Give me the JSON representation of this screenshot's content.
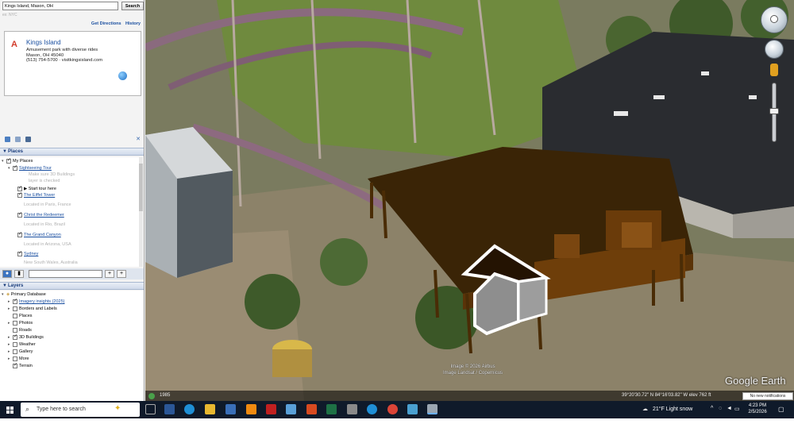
{
  "search": {
    "value": "Kings Island, Mason, OH",
    "button": "Search",
    "hint": "ex: NYC"
  },
  "links": {
    "directions": "Get Directions",
    "history": "History"
  },
  "result": {
    "pin": "A",
    "title": "Kings Island",
    "lines": [
      "Amusement park with diverse rides",
      "Mason, OH 45040",
      "(513) 754-5700 · visitkingsisland.com"
    ]
  },
  "places": {
    "header": "Places",
    "items": [
      {
        "label": "My Places"
      },
      {
        "label": "Sightseeing Tour",
        "sub1": "Make sure 3D Buildings",
        "sub2": "layer is checked"
      },
      {
        "label": "Start tour here"
      },
      {
        "label": "The Eiffel Tower",
        "sub": "Located in Paris, France"
      },
      {
        "label": "Christ the Redeemer",
        "sub": "Located in Rio, Brazil"
      },
      {
        "label": "The Grand Canyon",
        "sub": "Located in Arizona, USA"
      },
      {
        "label": "Sydney",
        "sub": "New South Wales, Australia"
      }
    ]
  },
  "layers": {
    "header": "Layers",
    "items": [
      {
        "label": "Primary Database"
      },
      {
        "label": "Imagery insights (2025)"
      },
      {
        "label": "Borders and Labels"
      },
      {
        "label": "Places"
      },
      {
        "label": "Photos"
      },
      {
        "label": "Roads"
      },
      {
        "label": "3D Buildings"
      },
      {
        "label": "Weather"
      },
      {
        "label": "Gallery"
      },
      {
        "label": "More"
      },
      {
        "label": "Terrain"
      }
    ]
  },
  "map": {
    "brand": "Google Earth",
    "credit1": "Image © 2026 Airbus",
    "credit2": "Image Landsat / Copernicus",
    "year": "1985",
    "coords": "39°20'30.72\" N    84°16'03.82\" W    elev  762 ft",
    "notification": "No new notifications"
  },
  "taskbar": {
    "search_placeholder": "Type here to search",
    "weather": "21°F  Light snow",
    "time": "4:23 PM",
    "date": "2/5/2026"
  },
  "colors": {
    "roof": "#3a2406",
    "deck": "#6e3e0a",
    "asphalt": "#2a2c30",
    "taskbar": "#0f1a2a"
  }
}
